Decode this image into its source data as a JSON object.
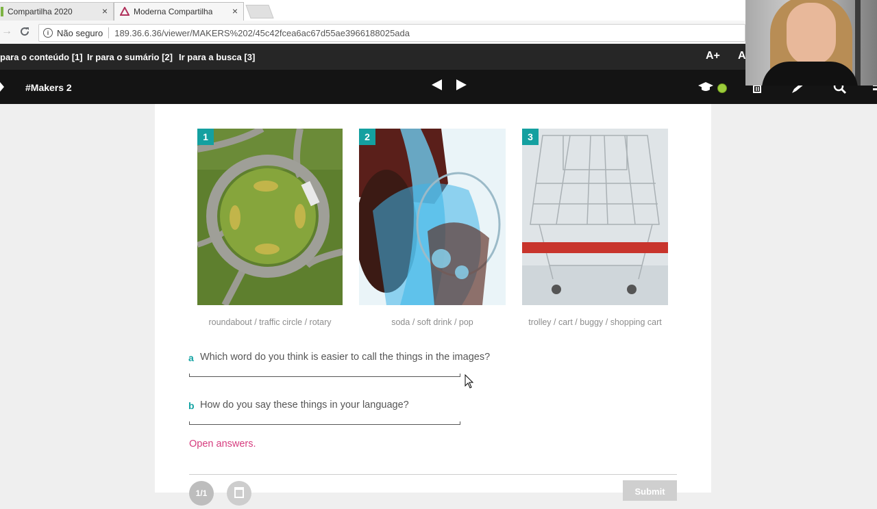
{
  "browser": {
    "tabs": [
      {
        "label": "Compartilha 2020",
        "close": "×"
      },
      {
        "label": "Moderna Compartilha",
        "close": "×"
      }
    ],
    "security_label": "Não seguro",
    "url": "189.36.6.36/viewer/MAKERS%202/45c42fcea6ac67d55ae3966188025ada",
    "back_icon": "→",
    "reload_icon": "C",
    "info_icon": "i"
  },
  "a11y_bar": {
    "links": [
      "para o conteúdo [1]",
      "Ir para o sumário [2]",
      "Ir para a busca [3]"
    ],
    "font_increase": "A+",
    "font_other": "A"
  },
  "reader": {
    "book_title": "#Makers 2"
  },
  "exercise": {
    "images": [
      {
        "number": "1",
        "caption": "roundabout / traffic circle / rotary"
      },
      {
        "number": "2",
        "caption": "soda / soft drink / pop"
      },
      {
        "number": "3",
        "caption": "trolley / cart / buggy / shopping cart"
      }
    ],
    "questions": [
      {
        "letter": "a",
        "text": "Which word do you think is easier to call the things in the images?"
      },
      {
        "letter": "b",
        "text": "How do you say these things in your language?"
      }
    ],
    "open_answers": "Open answers.",
    "pager": "1/1",
    "submit_label": "Submit"
  },
  "colors": {
    "accent_teal": "#14a0a0",
    "open_answers_pink": "#d63c7e",
    "status_green": "#9ccc3c"
  }
}
